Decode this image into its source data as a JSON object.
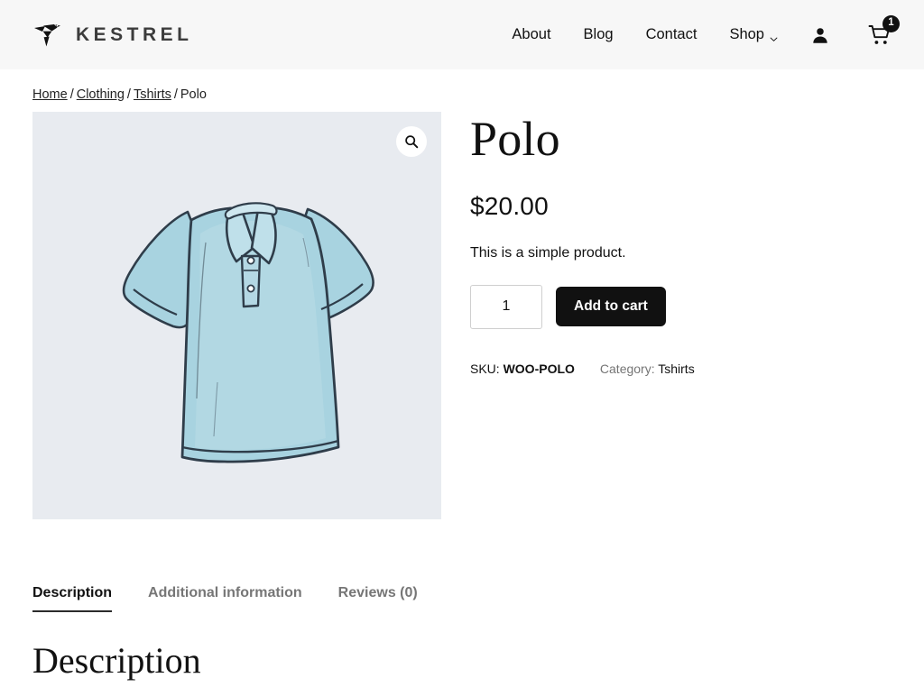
{
  "header": {
    "brand_name": "KESTREL",
    "brand_icon": "bird-origami-icon",
    "nav": [
      {
        "label": "About",
        "icon": null
      },
      {
        "label": "Blog",
        "icon": null
      },
      {
        "label": "Contact",
        "icon": null
      },
      {
        "label": "Shop",
        "icon": "chevron-down-icon"
      }
    ],
    "account_icon": "account-person-icon",
    "cart_icon": "shopping-cart-icon",
    "cart_count": "1",
    "background": "#f7f7f7"
  },
  "breadcrumb": {
    "items": [
      {
        "label": "Home",
        "is_link": true
      },
      {
        "label": "Clothing",
        "is_link": true
      },
      {
        "label": "Tshirts",
        "is_link": true
      },
      {
        "label": "Polo",
        "is_link": false
      }
    ],
    "separator": "/"
  },
  "gallery": {
    "zoom_icon": "magnifier-search-icon",
    "image_alt": "Light blue short-sleeve polo shirt illustration",
    "background": "#e8ebf0",
    "shirt_fill": "#a8d3e0",
    "shirt_outline": "#2f3d4a"
  },
  "product": {
    "title": "Polo",
    "price": "$20.00",
    "short_description": "This is a simple product.",
    "quantity_value": "1",
    "quantity_placeholder": "1",
    "add_to_cart_label": "Add to cart",
    "sku_label": "SKU:",
    "sku_value": "WOO-POLO",
    "category_label": "Category:",
    "category_value": "Tshirts",
    "accent_button_color": "#111111"
  },
  "tabs": {
    "items": [
      {
        "label": "Description",
        "active": true
      },
      {
        "label": "Additional information",
        "active": false
      },
      {
        "label": "Reviews (0)",
        "active": false
      }
    ]
  },
  "panel": {
    "heading": "Description"
  }
}
